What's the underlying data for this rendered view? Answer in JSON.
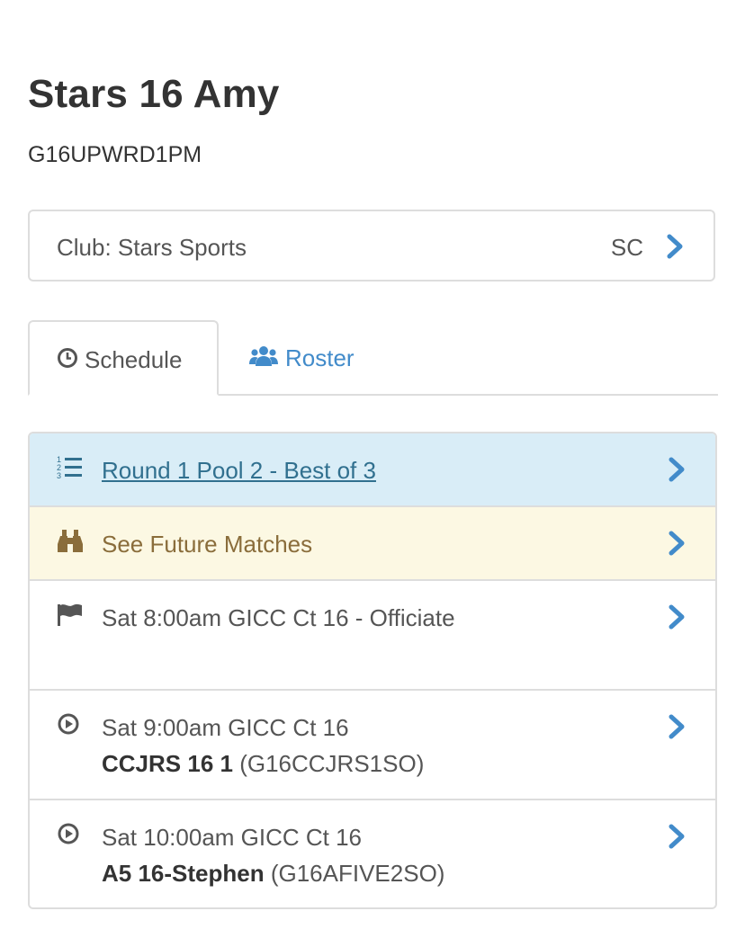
{
  "team": {
    "name": "Stars 16 Amy",
    "code": "G16UPWRD1PM"
  },
  "club": {
    "label": "Club: Stars Sports",
    "abbr": "SC"
  },
  "tabs": [
    {
      "label": "Schedule",
      "icon": "clock-icon",
      "active": true
    },
    {
      "label": "Roster",
      "icon": "users-icon",
      "active": false
    }
  ],
  "schedule": {
    "pool": {
      "label": "Round 1 Pool 2 - Best of 3",
      "icon": "ordered-list-icon"
    },
    "future": {
      "label": "See Future Matches",
      "icon": "binoculars-icon"
    },
    "items": [
      {
        "icon": "flag-icon",
        "line1": "Sat 8:00am GICC Ct 16 - Officiate"
      },
      {
        "icon": "play-circle-icon",
        "line1": "Sat 9:00am GICC Ct 16",
        "opponent": "CCJRS 16 1",
        "opponent_code": " (G16CCJRS1SO)"
      },
      {
        "icon": "play-circle-icon",
        "line1": "Sat 10:00am GICC Ct 16",
        "opponent": "A5 16-Stephen",
        "opponent_code": " (G16AFIVE2SO)"
      }
    ]
  },
  "colors": {
    "link": "#428bca",
    "info_bg": "#d9edf7",
    "info_text": "#31708f",
    "warn_bg": "#fcf8e3",
    "warn_text": "#8a6d3b",
    "border": "#dddddd"
  }
}
